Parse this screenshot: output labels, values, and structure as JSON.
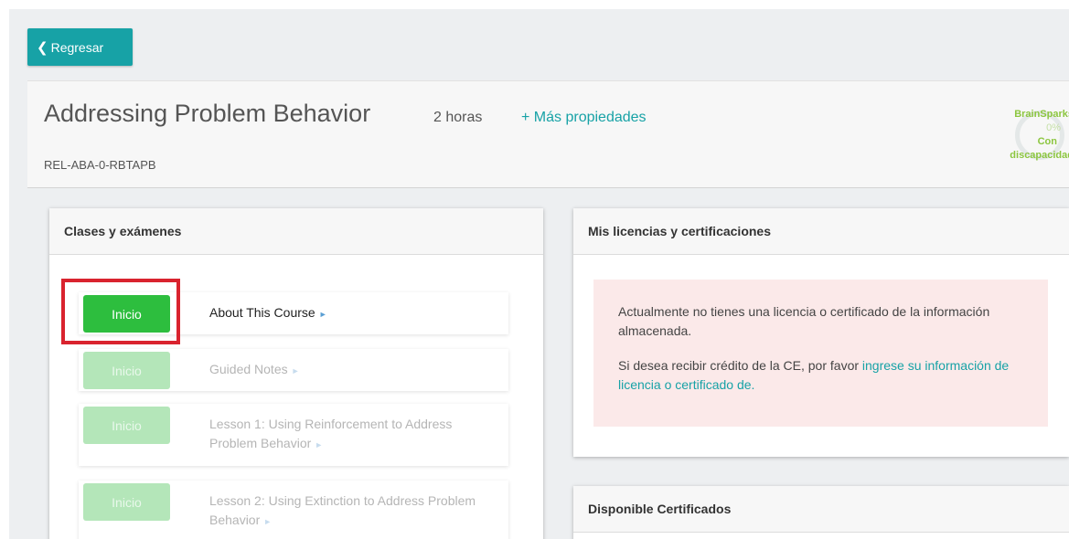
{
  "back_button": {
    "label": "Regresar",
    "icon": "chevron-left-icon"
  },
  "course": {
    "title": "Addressing Problem Behavior",
    "hours": "2 horas",
    "more_properties": "+ Más propiedades",
    "code": "REL-ABA-0-RBTAPB"
  },
  "brain_sparks": {
    "title": "BrainSparks",
    "percent": "0%",
    "status_line1": "Con",
    "status_line2": "discapacidad",
    "progress": 0
  },
  "classes_panel": {
    "title": "Clases y exámenes",
    "lessons": [
      {
        "button": "Inicio",
        "title": "About This Course",
        "enabled": true
      },
      {
        "button": "Inicio",
        "title": "Guided Notes",
        "enabled": false
      },
      {
        "button": "Inicio",
        "title": "Lesson 1: Using Reinforcement to Address Problem Behavior",
        "enabled": false
      },
      {
        "button": "Inicio",
        "title": "Lesson 2: Using Extinction to Address Problem Behavior",
        "enabled": false
      }
    ]
  },
  "licenses_panel": {
    "title": "Mis licencias y certificaciones",
    "notice_text": "Actualmente no tienes una licencia o certificado de la información almacenada.",
    "notice_prefix": "Si desea recibir crédito de la CE, por favor",
    "notice_link": "ingrese su información de licencia o certificado de."
  },
  "certificates_panel": {
    "title": "Disponible Certificados"
  },
  "colors": {
    "accent": "#17a2a6",
    "start_button": "#2dbe3e",
    "start_button_disabled": "#b4e6b9",
    "highlight": "#d9232e",
    "notice_bg": "#fbe9e9",
    "brain_sparks": "#8cc63f"
  }
}
